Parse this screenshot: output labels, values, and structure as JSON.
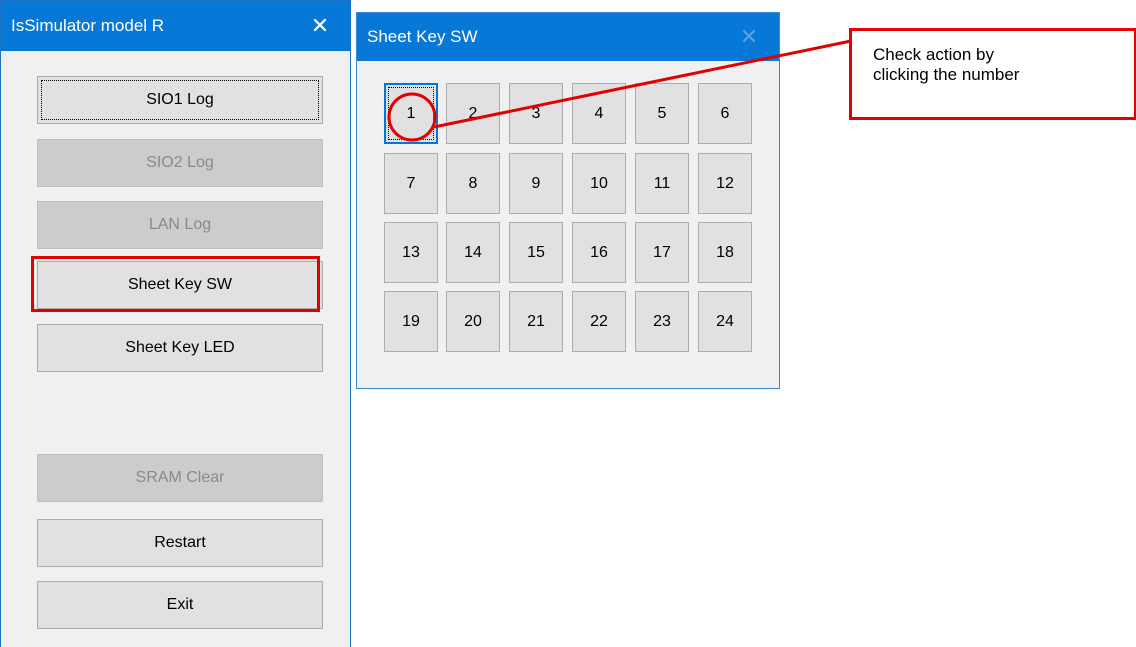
{
  "main_window": {
    "title": "IsSimulator model R",
    "close_glyph": "✕",
    "buttons": [
      {
        "label": "SIO1 Log",
        "enabled": true,
        "focused": true
      },
      {
        "label": "SIO2 Log",
        "enabled": false
      },
      {
        "label": "LAN Log",
        "enabled": false
      },
      {
        "label": "Sheet Key SW",
        "enabled": true,
        "highlighted": true
      },
      {
        "label": "Sheet Key LED",
        "enabled": true
      },
      {
        "label": "SRAM Clear",
        "enabled": false
      },
      {
        "label": "Restart",
        "enabled": true
      },
      {
        "label": "Exit",
        "enabled": true
      }
    ]
  },
  "sheet_window": {
    "title": "Sheet Key SW",
    "close_glyph": "✕",
    "keys": [
      "1",
      "2",
      "3",
      "4",
      "5",
      "6",
      "7",
      "8",
      "9",
      "10",
      "11",
      "12",
      "13",
      "14",
      "15",
      "16",
      "17",
      "18",
      "19",
      "20",
      "21",
      "22",
      "23",
      "24"
    ],
    "selected_key": "1"
  },
  "annotation": {
    "callout_line1": "Check action by",
    "callout_line2": "clicking the number",
    "color": "#e20000"
  },
  "colors": {
    "titlebar": "#0778d7",
    "window_bg": "#f0f0f0",
    "button_bg": "#e1e1e1",
    "disabled_bg": "#cccccc"
  }
}
